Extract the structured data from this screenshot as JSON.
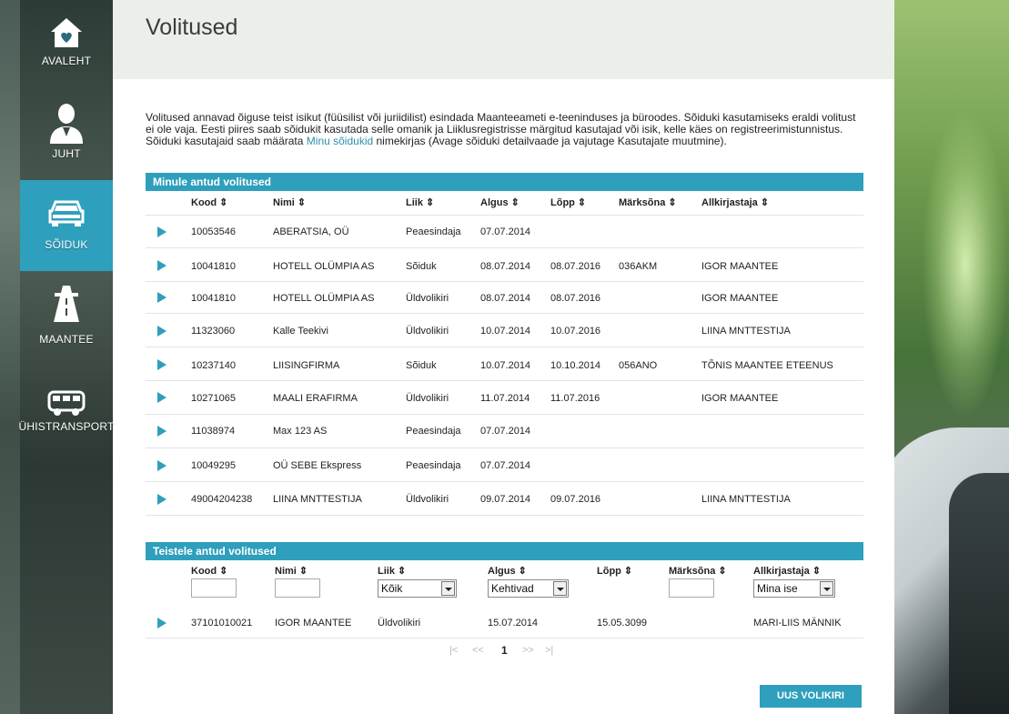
{
  "nav": {
    "home": "AVALEHT",
    "driver": "JUHT",
    "vehicle": "SÕIDUK",
    "road": "MAANTEE",
    "transport": "ÜHISTRANSPORT"
  },
  "page": {
    "title": "Volitused",
    "intro_pre": "Volitused annavad õiguse teist isikut (füüsilist või juriidilist) esindada Maanteeameti e-teeninduses ja büroodes. Sõiduki kasutamiseks eraldi volitust ei ole vaja. Eesti piires saab sõidukit kasutada selle omanik ja Liiklusregistrisse märgitud kasutajad või isik, kelle käes on registreerimistunnistus. Sõiduki kasutajaid saab määrata ",
    "intro_link": "Minu sõidukid",
    "intro_post": " nimekirjas (Avage sõiduki detailvaade ja vajutage Kasutajate muutmine)."
  },
  "given_to_me": {
    "title": "Minule antud volitused",
    "headers": [
      "Kood ⇕",
      "Nimi ⇕",
      "Liik ⇕",
      "Algus ⇕",
      "Lõpp ⇕",
      "Märksõna ⇕",
      "Allkirjastaja ⇕"
    ],
    "rows": [
      [
        "10053546",
        "ABERATSIA, OÜ",
        "Peaesindaja",
        "07.07.2014",
        "",
        "",
        ""
      ],
      [
        "10041810",
        "HOTELL OLÜMPIA AS",
        "Sõiduk",
        "08.07.2014",
        "08.07.2016",
        "036AKM",
        "IGOR MAANTEE"
      ],
      [
        "10041810",
        "HOTELL OLÜMPIA AS",
        "Üldvolikiri",
        "08.07.2014",
        "08.07.2016",
        "",
        "IGOR MAANTEE"
      ],
      [
        "11323060",
        "Kalle Teekivi",
        "Üldvolikiri",
        "10.07.2014",
        "10.07.2016",
        "",
        "LIINA MNTTESTIJA"
      ],
      [
        "10237140",
        "LIISINGFIRMA",
        "Sõiduk",
        "10.07.2014",
        "10.10.2014",
        "056ANO",
        "TÕNIS MAANTEE ETEENUS"
      ],
      [
        "10271065",
        "MAALI ERAFIRMA",
        "Üldvolikiri",
        "11.07.2014",
        "11.07.2016",
        "",
        "IGOR MAANTEE"
      ],
      [
        "11038974",
        "Max 123 AS",
        "Peaesindaja",
        "07.07.2014",
        "",
        "",
        ""
      ],
      [
        "10049295",
        "OÜ SEBE Ekspress",
        "Peaesindaja",
        "07.07.2014",
        "",
        "",
        ""
      ],
      [
        "49004204238",
        "LIINA MNTTESTIJA",
        "Üldvolikiri",
        "09.07.2014",
        "09.07.2016",
        "",
        "LIINA MNTTESTIJA"
      ]
    ]
  },
  "given_to_others": {
    "title": "Teistele antud volitused",
    "headers": [
      "Kood ⇕",
      "Nimi ⇕",
      "Liik ⇕",
      "Algus ⇕",
      "Lõpp ⇕",
      "Märksõna ⇕",
      "Allkirjastaja ⇕"
    ],
    "filters": {
      "liik": "Kõik",
      "algus": "Kehtivad",
      "allkirjastaja": "Mina ise"
    },
    "rows": [
      [
        "37101010021",
        "IGOR MAANTEE",
        "Üldvolikiri",
        "15.07.2014",
        "15.05.3099",
        "",
        "MARI-LIIS MÄNNIK"
      ]
    ],
    "pager": {
      "first": "|<",
      "prev": "<<",
      "current": "1",
      "next": ">>",
      "last": ">|"
    }
  },
  "actions": {
    "new_button": "UUS VOLIKIRI"
  },
  "colors": {
    "accent": "#2e9fbc",
    "header_bg": "#ebeee9"
  }
}
